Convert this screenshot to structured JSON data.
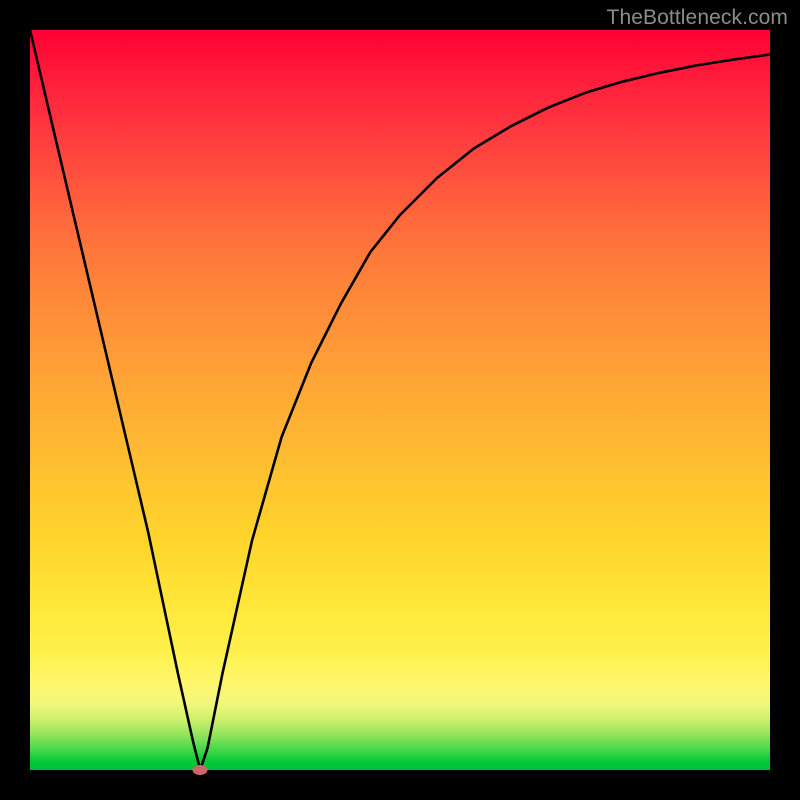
{
  "watermark": "TheBottleneck.com",
  "chart_data": {
    "type": "line",
    "title": "",
    "xlabel": "",
    "ylabel": "",
    "x_range": [
      0,
      100
    ],
    "y_range": [
      0,
      100
    ],
    "series": [
      {
        "name": "bottleneck-curve",
        "x": [
          0,
          4,
          8,
          12,
          16,
          20,
          22,
          23,
          24,
          26,
          30,
          34,
          38,
          42,
          46,
          50,
          55,
          60,
          65,
          70,
          75,
          80,
          85,
          90,
          95,
          100
        ],
        "y": [
          100,
          83,
          66,
          49,
          32,
          13,
          4,
          0,
          3,
          13,
          31,
          45,
          55,
          63,
          70,
          75,
          80,
          84,
          87,
          89.5,
          91.5,
          93,
          94.2,
          95.2,
          96,
          96.7
        ]
      }
    ],
    "marker": {
      "x": 23,
      "y": 0,
      "name": "optimal-point"
    },
    "grid": false,
    "legend": false
  }
}
